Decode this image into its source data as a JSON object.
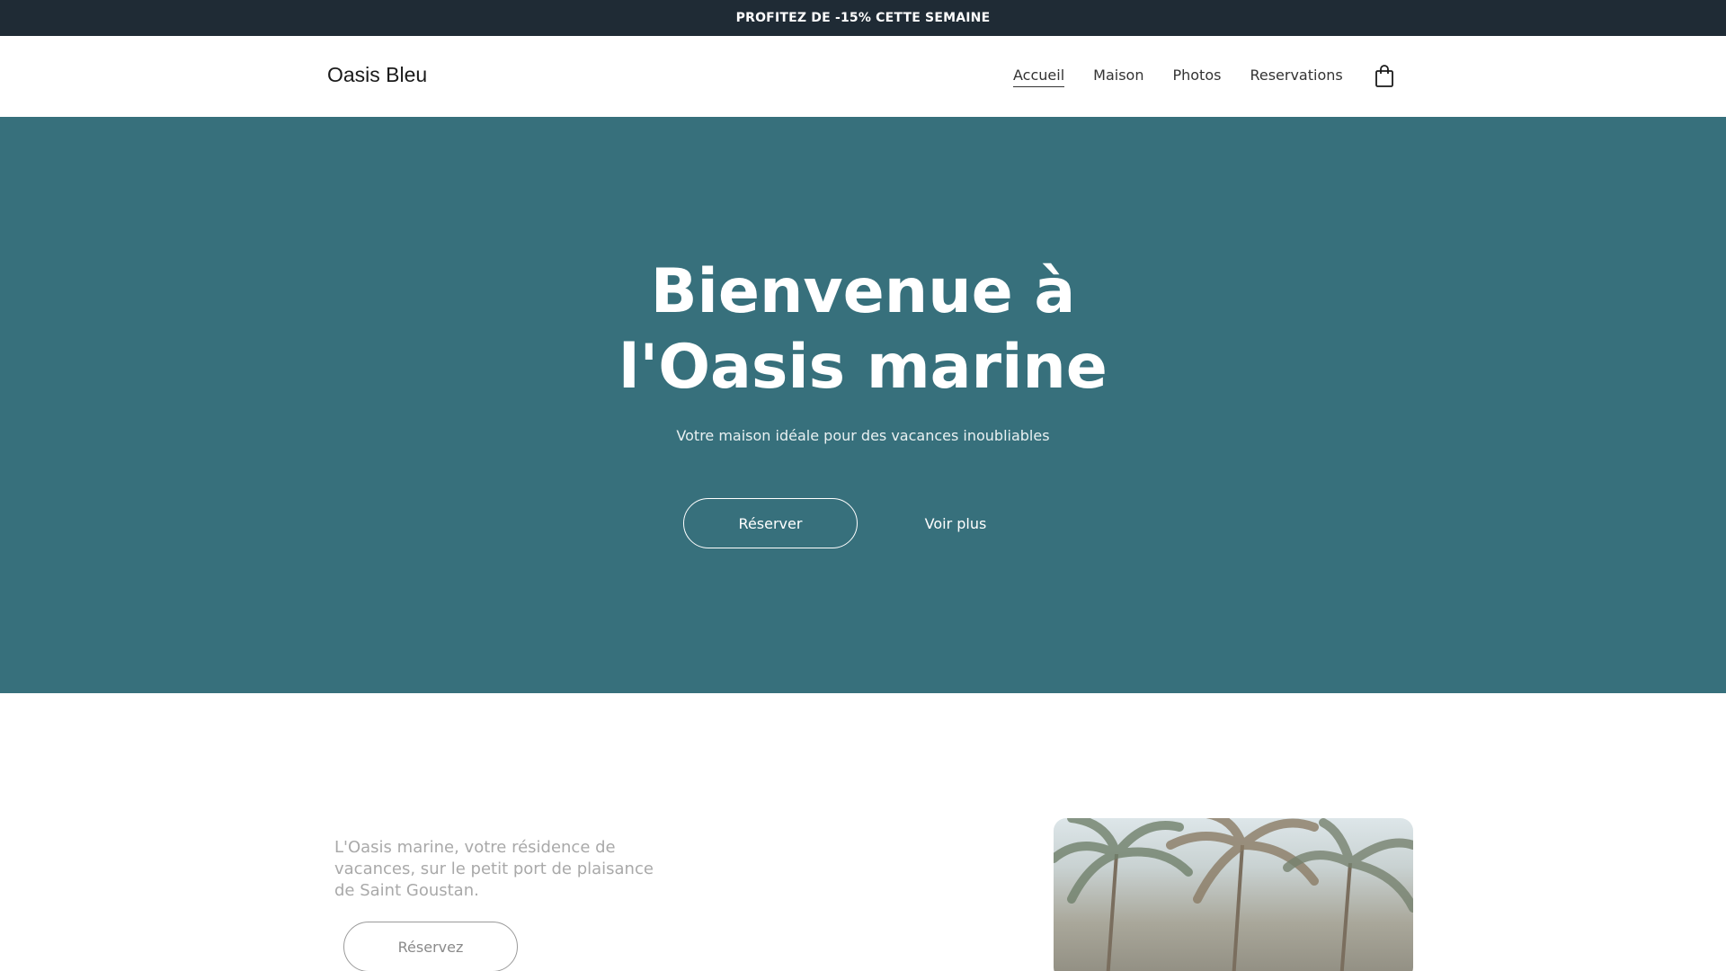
{
  "promo": {
    "text": "PROFITEZ DE -15% CETTE SEMAINE"
  },
  "header": {
    "brand": "Oasis Bleu",
    "nav": [
      {
        "label": "Accueil",
        "active": true
      },
      {
        "label": "Maison",
        "active": false
      },
      {
        "label": "Photos",
        "active": false
      },
      {
        "label": "Reservations",
        "active": false
      }
    ],
    "cart_icon": "shopping-bag-icon"
  },
  "hero": {
    "title_line1": "Bienvenue à",
    "title_line2": "l'Oasis marine",
    "subtitle": "Votre maison idéale pour des vacances inoubliables",
    "primary_button": "Réserver",
    "secondary_button": "Voir plus",
    "background_color": "#37707c"
  },
  "intro": {
    "text": "L'Oasis marine, votre résidence de vacances, sur le petit port de plaisance de Saint Goustan.",
    "button": "Réservez",
    "image": "palm-trees-photo"
  },
  "colors": {
    "promo_bar": "#1f2b35",
    "accent": "#37707c"
  }
}
